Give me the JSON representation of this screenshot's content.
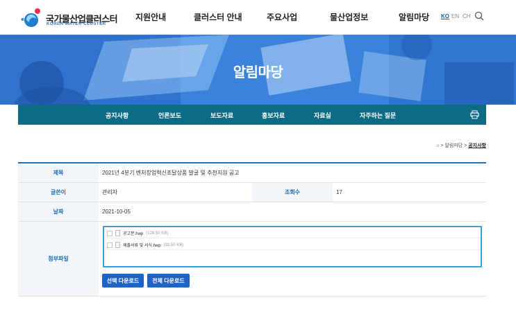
{
  "header": {
    "logo_title": "국가물산업클러스터",
    "logo_sub": "KOREA WATER CLUSTER",
    "nav": [
      "지원안내",
      "클러스터 안내",
      "주요사업",
      "물산업정보",
      "알림마당"
    ],
    "langs": [
      "KO",
      "EN",
      "CH"
    ]
  },
  "banner": {
    "title": "알림마당"
  },
  "subnav": {
    "items": [
      "공지사항",
      "언론보도",
      "보도자료",
      "홍보자료",
      "자료실",
      "자주하는 질문"
    ]
  },
  "breadcrumb": {
    "parent": "알림마당",
    "current": "공지사항",
    "sep": ">"
  },
  "post": {
    "title_label": "제목",
    "title": "2021년 4분기 벤처창업혁신조달상품 발굴 및 추천지원 공고",
    "author_label": "글쓴이",
    "author": "관리자",
    "views_label": "조회수",
    "views": "17",
    "date_label": "날짜",
    "date": "2021-10-05",
    "files_label": "첨부파일",
    "files": [
      {
        "name": "공고문.hwp",
        "size": "(128.50 KB)"
      },
      {
        "name": "제출서류 및 서식.hwp",
        "size": "(92.50 KB)"
      }
    ],
    "btn_selected": "선택 다운로드",
    "btn_all": "전체 다운로드"
  }
}
